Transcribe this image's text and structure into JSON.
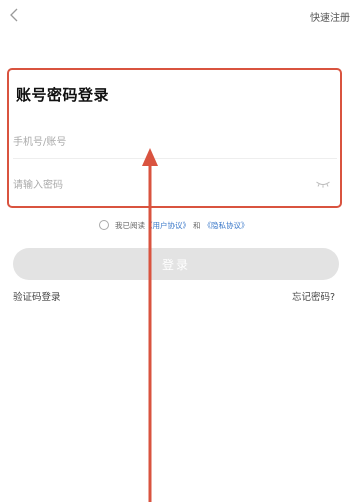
{
  "header": {
    "register_label": "快速注册"
  },
  "login": {
    "title": "账号密码登录",
    "account_placeholder": "手机号/账号",
    "password_placeholder": "请输入密码",
    "agreement": {
      "prefix": "我已阅读",
      "user_agreement": "《用户协议》",
      "conjunction": "和",
      "privacy_policy": "《隐私协议》"
    },
    "submit_label": "登录",
    "sms_login_label": "验证码登录",
    "forgot_password_label": "忘记密码?"
  },
  "colors": {
    "annotation": "#d9533f",
    "link": "#3a78c9",
    "button_disabled": "#e3e3e3"
  },
  "icons": {
    "back": "chevron-left-icon",
    "password_toggle": "eye-closed-icon"
  }
}
